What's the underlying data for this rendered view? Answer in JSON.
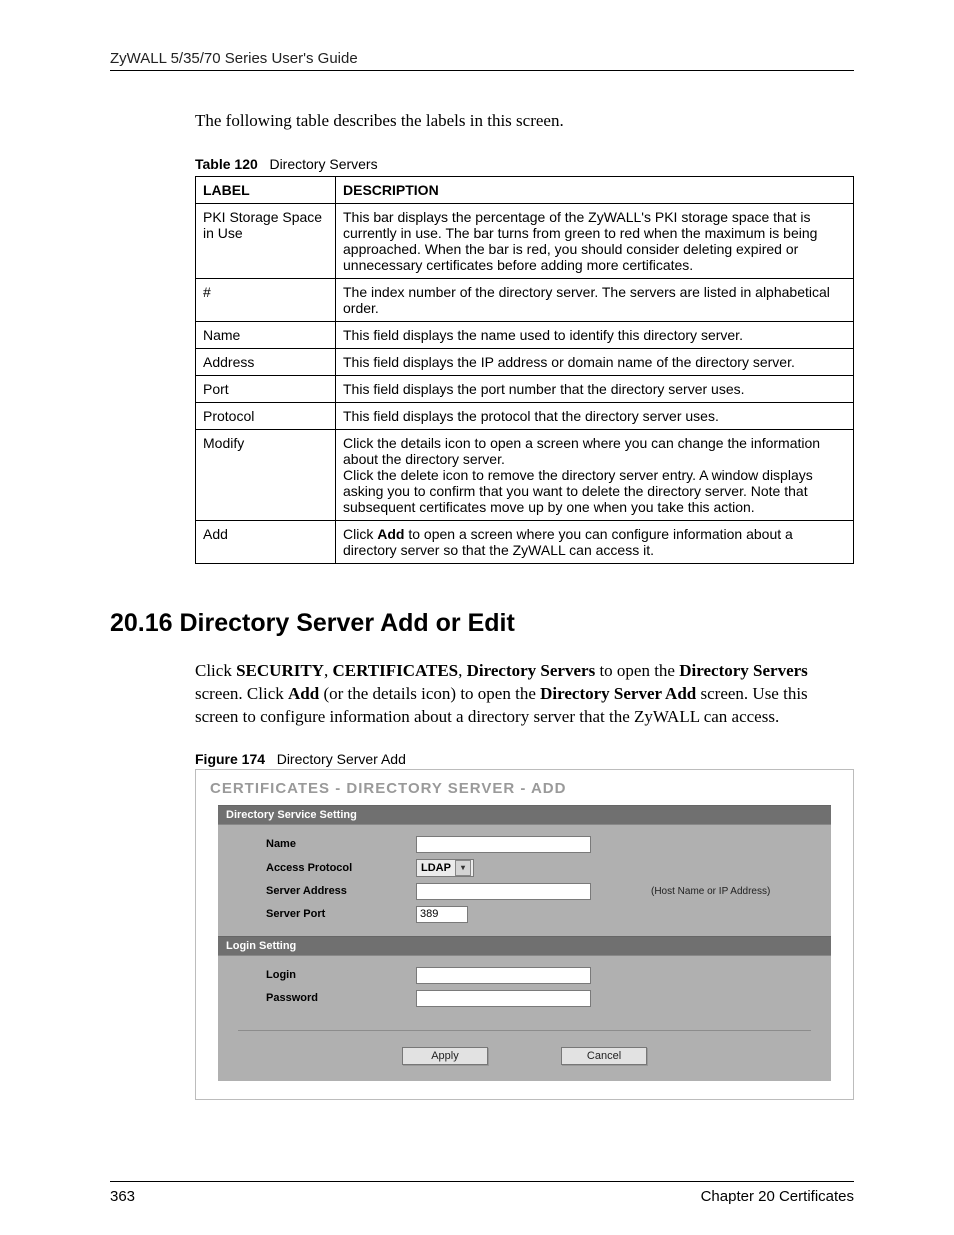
{
  "header": {
    "guide": "ZyWALL 5/35/70 Series User's Guide"
  },
  "intro": "The following table describes the labels in this screen.",
  "table_caption": {
    "num": "Table 120",
    "title": "Directory Servers"
  },
  "table": {
    "headers": {
      "label": "LABEL",
      "description": "DESCRIPTION"
    },
    "rows": [
      {
        "label": "PKI Storage Space in Use",
        "desc": "This bar displays the percentage of the ZyWALL's PKI storage space that is currently in use. The bar turns from green to red when the maximum is being approached. When the bar is red, you should consider deleting expired or unnecessary certificates before adding more certificates."
      },
      {
        "label": "#",
        "desc": "The index number of the directory server. The servers are listed in alphabetical order."
      },
      {
        "label": "Name",
        "desc": "This field displays the name used to identify this directory server."
      },
      {
        "label": "Address",
        "desc": "This field displays the IP address or domain name of the directory server."
      },
      {
        "label": "Port",
        "desc": "This field displays the port number that the directory server uses."
      },
      {
        "label": "Protocol",
        "desc": "This field displays the protocol that the directory server uses."
      },
      {
        "label": "Modify",
        "desc": "Click the details icon to open a screen where you can change the information about the directory server.\nClick the delete icon to remove the directory server entry. A window displays asking you to confirm that you want to delete the directory server. Note that subsequent certificates move up by one when you take this action."
      },
      {
        "label": "Add",
        "desc_prefix": "Click ",
        "desc_bold": "Add",
        "desc_suffix": " to open a screen where you can configure information about a directory server so that the ZyWALL can access it."
      }
    ]
  },
  "section": {
    "heading": "20.16  Directory Server Add or Edit",
    "body_parts": {
      "p1_a": "Click ",
      "p1_b": "SECURITY",
      "p1_c": ", ",
      "p1_d": "CERTIFICATES",
      "p1_e": ", ",
      "p1_f": "Directory Servers",
      "p1_g": " to open the ",
      "p1_h": "Directory Servers",
      "p1_i": " screen. Click ",
      "p1_j": "Add",
      "p1_k": " (or the details icon) to open the ",
      "p1_l": "Directory Server Add",
      "p1_m": " screen. Use this screen to configure information about a directory server that the ZyWALL can access."
    }
  },
  "figure_caption": {
    "num": "Figure 174",
    "title": "Directory Server Add"
  },
  "screenshot": {
    "title": "CERTIFICATES - DIRECTORY SERVER - ADD",
    "section1": "Directory Service Setting",
    "labels": {
      "name": "Name",
      "access_protocol": "Access Protocol",
      "server_address": "Server Address",
      "server_port": "Server Port"
    },
    "access_protocol_value": "LDAP",
    "server_address_hint": "(Host Name or IP Address)",
    "server_port_value": "389",
    "section2": "Login Setting",
    "labels2": {
      "login": "Login",
      "password": "Password"
    },
    "buttons": {
      "apply": "Apply",
      "cancel": "Cancel"
    }
  },
  "footer": {
    "page": "363",
    "chapter": "Chapter 20 Certificates"
  }
}
